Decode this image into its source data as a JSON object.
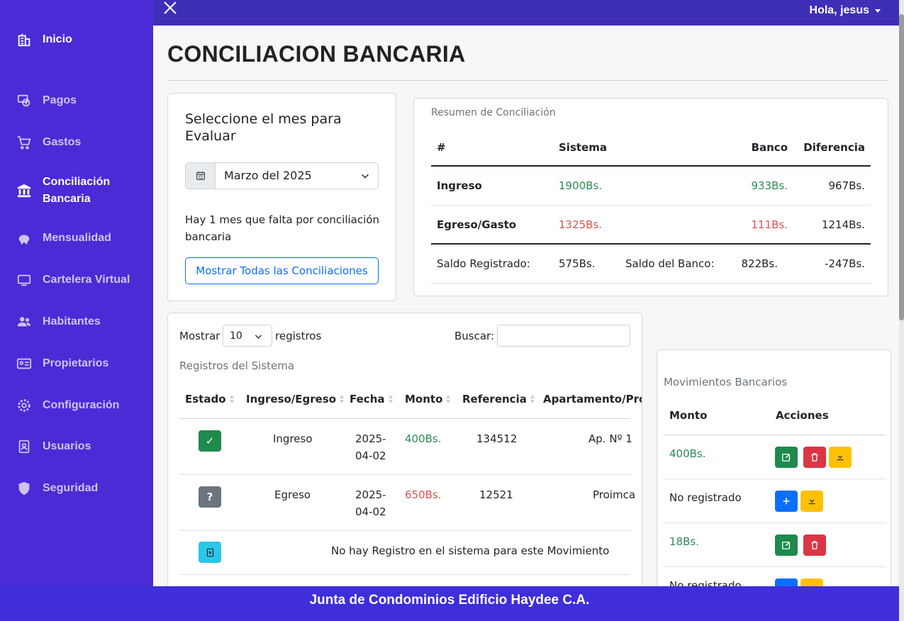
{
  "sidebar": {
    "items": [
      {
        "label": "Inicio",
        "icon": "building-icon"
      },
      {
        "label": "Pagos",
        "icon": "payments-icon"
      },
      {
        "label": "Gastos",
        "icon": "cart-icon"
      },
      {
        "label": "Conciliación Bancaria",
        "icon": "bank-icon"
      },
      {
        "label": "Mensualidad",
        "icon": "piggy-bank-icon"
      },
      {
        "label": "Cartelera Virtual",
        "icon": "monitor-icon"
      },
      {
        "label": "Habitantes",
        "icon": "users-icon"
      },
      {
        "label": "Propietarios",
        "icon": "id-card-icon"
      },
      {
        "label": "Configuración",
        "icon": "gear-icon"
      },
      {
        "label": "Usuarios",
        "icon": "user-badge-icon"
      },
      {
        "label": "Seguridad",
        "icon": "shield-icon"
      }
    ]
  },
  "topbar": {
    "user_greeting": "Hola, jesus"
  },
  "page": {
    "title": "CONCILIACION BANCARIA"
  },
  "month_card": {
    "heading": "Seleccione el mes para Evaluar",
    "selected_month": "Marzo del 2025",
    "message": "Hay 1 mes que falta por conciliación bancaria",
    "button_label": "Mostrar Todas las Conciliaciones"
  },
  "summary": {
    "caption": "Resumen de Conciliación",
    "headers": {
      "num": "#",
      "sistema": "Sistema",
      "banco": "Banco",
      "diferencia": "Diferencia"
    },
    "ingreso": {
      "label": "Ingreso",
      "sistema": "1900Bs.",
      "banco": "933Bs.",
      "diferencia": "967Bs."
    },
    "egreso": {
      "label": "Egreso/Gasto",
      "sistema": "1325Bs.",
      "banco": "111Bs.",
      "diferencia": "1214Bs."
    },
    "saldo": {
      "label_registrado": "Saldo Registrado:",
      "registrado": "575Bs.",
      "label_banco": "Saldo del Banco:",
      "banco": "822Bs.",
      "diferencia": "-247Bs."
    }
  },
  "records": {
    "show_label": "Mostrar",
    "page_length": "10",
    "records_label": "registros",
    "search_label": "Buscar:",
    "caption": "Registros del Sistema",
    "headers": {
      "estado": "Estado",
      "tipo": "Ingreso/Egreso",
      "fecha": "Fecha",
      "monto": "Monto",
      "referencia": "Referencia",
      "apartamento": "Apartamento/Pro"
    },
    "rows": [
      {
        "estado": "✓",
        "tipo": "Ingreso",
        "fecha1": "2025-",
        "fecha2": "04-02",
        "monto": "400Bs.",
        "referencia": "134512",
        "apartamento": "Ap. Nº 1"
      },
      {
        "estado": "?",
        "tipo": "Egreso",
        "fecha1": "2025-",
        "fecha2": "04-02",
        "monto": "650Bs.",
        "referencia": "12521",
        "apartamento": "Proimca"
      }
    ],
    "empty_message": "No hay Registro en el sistema para este Movimiento"
  },
  "bank": {
    "caption": "Movimientos Bancarios",
    "headers": {
      "monto": "Monto",
      "acciones": "Acciones"
    },
    "rows": [
      {
        "monto": "400Bs."
      },
      {
        "monto": "No registrado"
      },
      {
        "monto": "18Bs."
      },
      {
        "monto": "No registrado"
      }
    ]
  },
  "footer": {
    "text": "Junta de Condominios Edificio Haydee C.A."
  },
  "colors": {
    "sidebar": "#4a2bd6",
    "topbar": "#3e2fb8",
    "footer": "#3f2ed9",
    "positive": "#2e8b57",
    "negative": "#d9534f",
    "primary": "#0d6efd"
  }
}
